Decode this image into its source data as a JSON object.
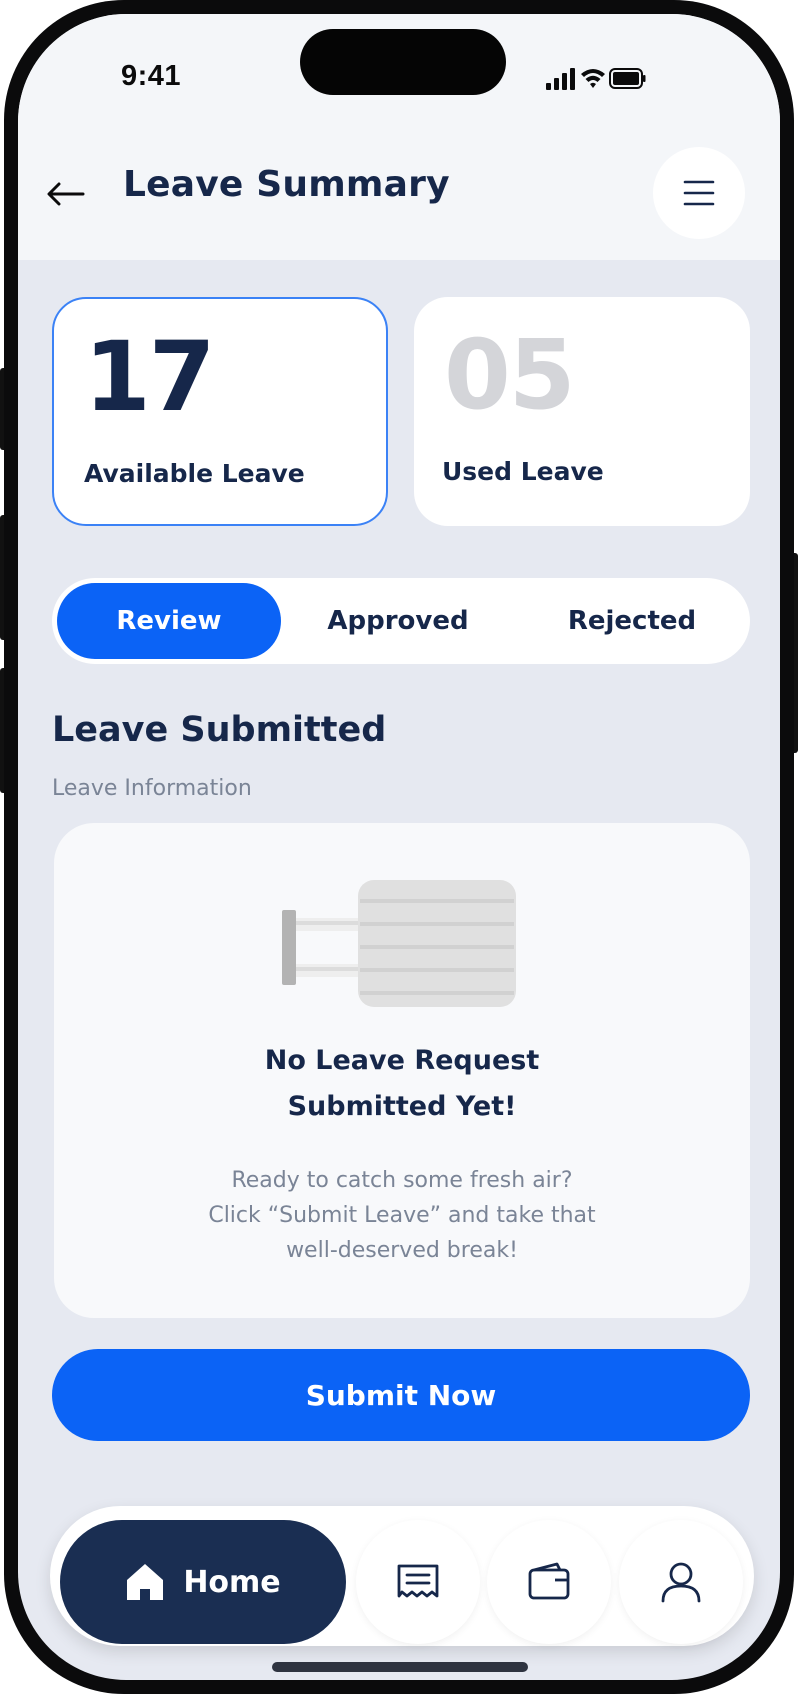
{
  "status_bar": {
    "time": "9:41"
  },
  "header": {
    "title": "Leave Summary",
    "back_icon": "arrow-left-icon",
    "menu_icon": "hamburger-menu-icon"
  },
  "stats": {
    "available": {
      "value": "17",
      "label": "Available Leave"
    },
    "used": {
      "value": "05",
      "label": "Used Leave"
    }
  },
  "tabs": [
    {
      "label": "Review",
      "selected": true
    },
    {
      "label": "Approved",
      "selected": false
    },
    {
      "label": "Rejected",
      "selected": false
    }
  ],
  "section": {
    "title": "Leave Submitted",
    "subtitle": "Leave Information"
  },
  "empty_state": {
    "title_line1": "No Leave Request",
    "title_line2": "Submitted Yet!",
    "desc_line1": "Ready to catch some fresh air?",
    "desc_line2": "Click “Submit Leave” and  take that",
    "desc_line3": "well-deserved break!"
  },
  "submit_button": {
    "label": "Submit Now"
  },
  "bottom_nav": {
    "home_label": "Home",
    "items": [
      "home-icon",
      "receipt-icon",
      "wallet-icon",
      "profile-icon"
    ]
  },
  "colors": {
    "primary": "#0b63f6",
    "navy": "#16274a",
    "nav_active": "#1a2e52",
    "background": "#e6e9f1",
    "muted": "#7a8496"
  }
}
